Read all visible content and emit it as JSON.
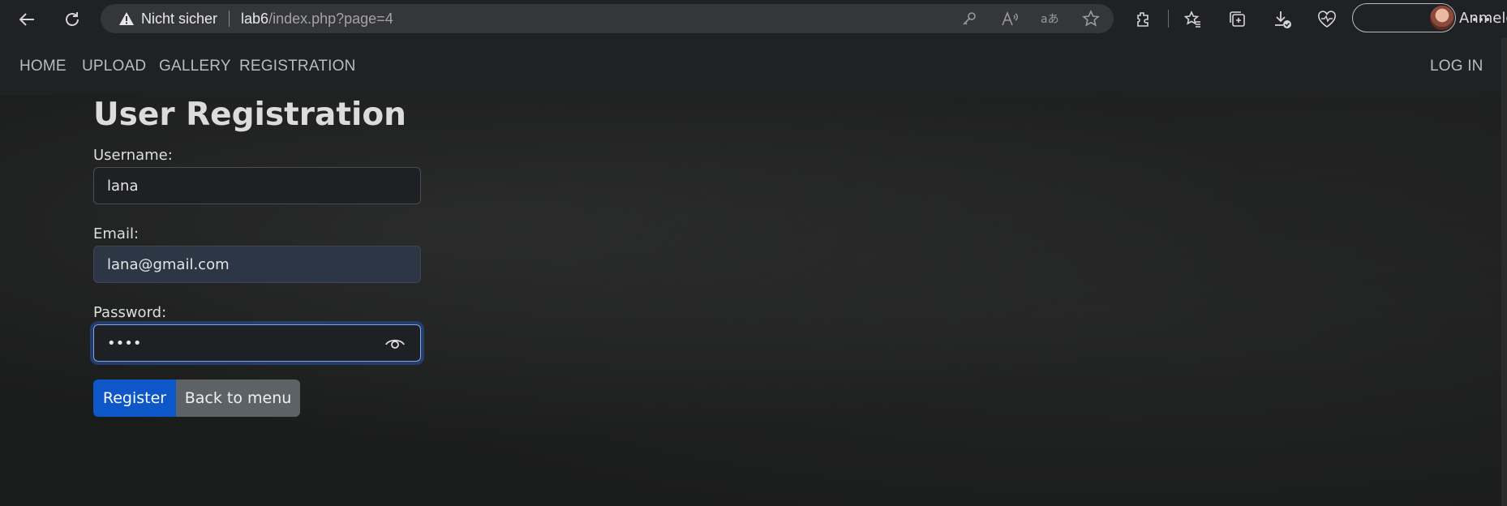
{
  "browser": {
    "address": {
      "security_text": "Nicht sicher",
      "url_host": "lab6",
      "url_path": "/index.php?page=4"
    },
    "signin_label": "Anmelden"
  },
  "navbar": {
    "links": [
      "HOME",
      "UPLOAD",
      "GALLERY",
      "REGISTRATION"
    ],
    "login": "LOG IN"
  },
  "form": {
    "title": "User Registration",
    "username_label": "Username:",
    "username_value": "lana",
    "email_label": "Email:",
    "email_value": "lana@gmail.com",
    "password_label": "Password:",
    "password_value": "••••",
    "register_label": "Register",
    "back_label": "Back to menu"
  },
  "colors": {
    "primary_button": "#0d57c9",
    "secondary_button": "#5d6266",
    "navbar": "#1f2224"
  }
}
